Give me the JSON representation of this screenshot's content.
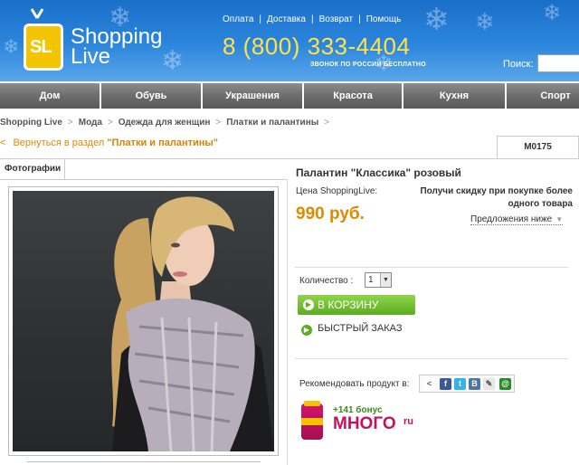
{
  "header": {
    "logo_sl": "SL",
    "logo_line1": "Shopping",
    "logo_line2": "Live",
    "links": [
      "Оплата",
      "Доставка",
      "Возврат",
      "Помощь"
    ],
    "phone": "8 (800) 333-4404",
    "phone_note": "ЗВОНОК ПО РОССИИ БЕСПЛАТНО",
    "search_label": "Поиск:",
    "search_value": ""
  },
  "nav": [
    "Дом",
    "Обувь",
    "Украшения",
    "Красота",
    "Кухня",
    "Спорт"
  ],
  "breadcrumb": [
    "Shopping Live",
    "Мода",
    "Одежда для женщин",
    "Платки и палантины"
  ],
  "back": {
    "prefix": "Вернуться в раздел ",
    "section": "\"Платки и палантины\""
  },
  "product": {
    "code": "M0175",
    "title": "Палантин \"Классика\" розовый",
    "price_label": "Цена ShoppingLive:",
    "price": "990 руб.",
    "discount": "Получи скидку при покупке более одного товара",
    "offers": "Предложения ниже",
    "qty_label": "Количество :",
    "qty_value": "1",
    "cart_label": "В КОРЗИНУ",
    "quick_label": "БЫСТРЫЙ ЗАКАЗ",
    "recommend_label": "Рекомендовать продукт в:"
  },
  "tabs": {
    "photos": "Фотографии"
  },
  "bonus": {
    "text": "+141 бонус",
    "brand": "МНОГО",
    "brand_suffix": "ru"
  },
  "colors": {
    "accent": "#e08a00",
    "nav_bg": "#6a6a6a",
    "button_green": "#5cad20",
    "header_blue": "#1a6fc9"
  }
}
